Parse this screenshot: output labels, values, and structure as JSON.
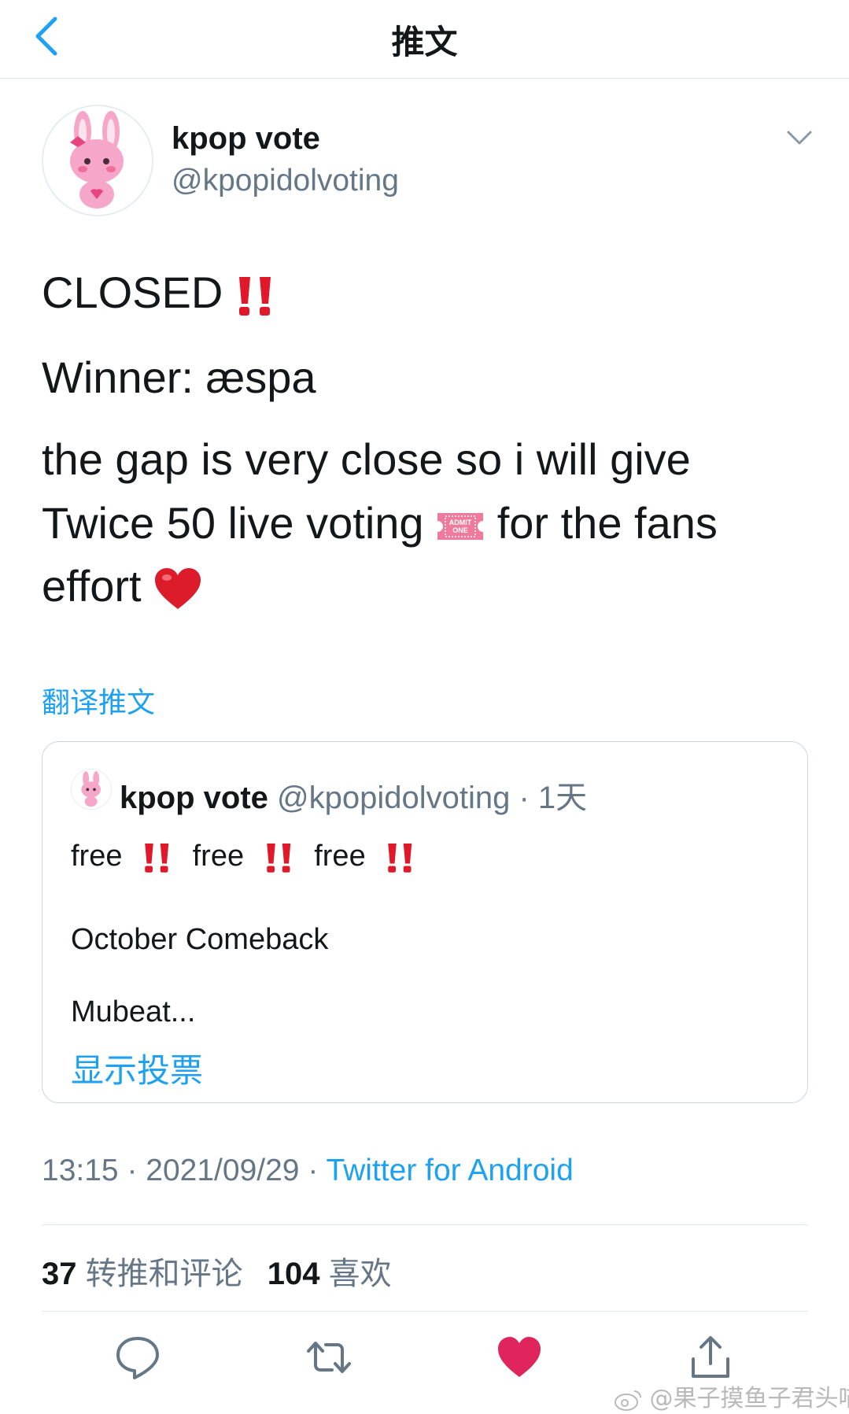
{
  "header": {
    "title": "推文"
  },
  "author": {
    "display_name": "kpop vote",
    "handle": "@kpopidolvoting"
  },
  "tweet": {
    "line1": "CLOSED",
    "line2": "Winner: æspa",
    "line3": "the gap is very close so i will give",
    "line4a": "Twice 50 live voting",
    "line4b": "for the fans",
    "line5": "effort",
    "ticket_text_1": "ADMIT",
    "ticket_text_2": "ONE"
  },
  "translate_label": "翻译推文",
  "quoted": {
    "display_name": "kpop vote",
    "handle_meta": "@kpopidolvoting · 1天",
    "free_word": "free",
    "line2": "October Comeback",
    "line3": "Mubeat...",
    "poll_link": "显示投票"
  },
  "meta": {
    "time": "13:15",
    "date": "2021/09/29",
    "source": "Twitter for Android",
    "sep": " · "
  },
  "stats": {
    "retweets_count": "37",
    "retweets_label": "转推和评论",
    "likes_count": "104",
    "likes_label": "喜欢"
  },
  "watermark": "@果子摸鱼子君头喵",
  "colors": {
    "link": "#1da1f2",
    "muted": "#657786",
    "like": "#e0245e",
    "exclaim": "#e0192a"
  },
  "icons": [
    "chevron-left-icon",
    "chevron-down-icon",
    "reply-icon",
    "retweet-icon",
    "heart-icon",
    "share-icon",
    "double-exclamation-icon",
    "ticket-icon",
    "red-heart-icon",
    "weibo-icon"
  ]
}
